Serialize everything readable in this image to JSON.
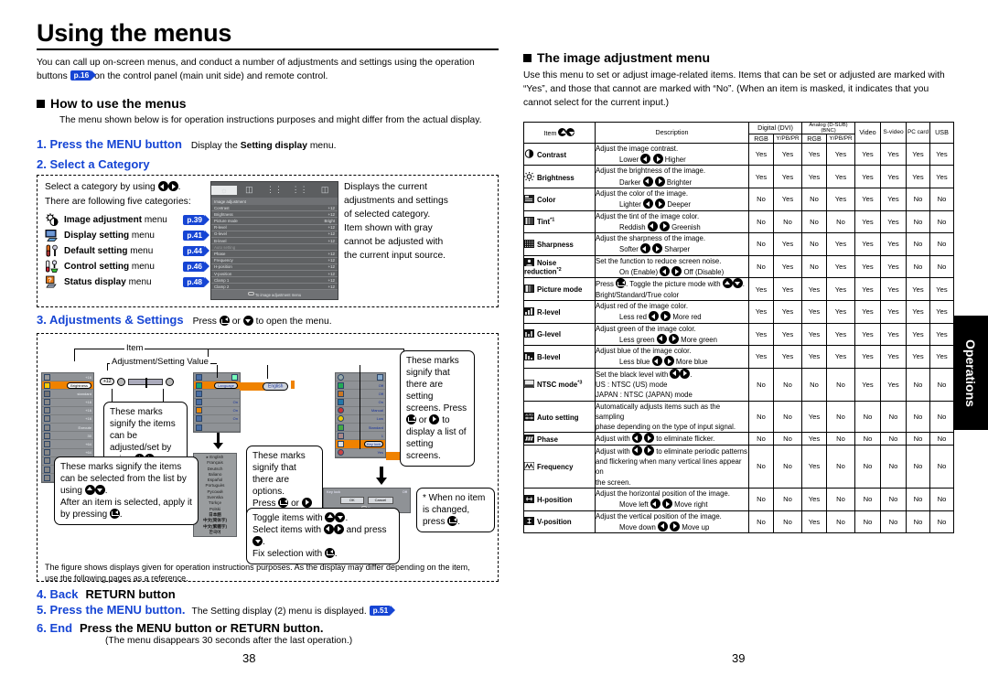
{
  "colors": {
    "accent_blue": "#1645d4",
    "osd_orange": "#ef8200",
    "osd_grey": "#686a6c",
    "tab_black": "#000000"
  },
  "left": {
    "title": "Using the menus",
    "intro_a": "You can call up on-screen menus, and conduct a number of adjustments and settings using the operation buttons",
    "intro_badge": "p.16",
    "intro_b": "on the control panel (main unit side) and remote control.",
    "section_how": "How to use the menus",
    "how_note": "The menu shown below is for operation instructions purposes and might differ from the actual display.",
    "step1_label": "1. Press the MENU button",
    "step1_text_a": "Display the",
    "step1_text_b": "Setting display",
    "step1_text_c": "menu.",
    "step2_label": "2. Select a Category",
    "step2_select_a": "Select a category by using",
    "step2_select_b": ".",
    "step2_five": "There are following five categories:",
    "categories": [
      {
        "icon": "image-adjustment-icon",
        "label": "Image adjustment",
        "suffix": "menu",
        "page": "p.39"
      },
      {
        "icon": "display-setting-icon",
        "label": "Display setting",
        "suffix": "menu",
        "page": "p.41"
      },
      {
        "icon": "default-setting-icon",
        "label": "Default setting",
        "suffix": "menu",
        "page": "p.44"
      },
      {
        "icon": "control-setting-icon",
        "label": "Control setting",
        "suffix": "menu",
        "page": "p.46"
      },
      {
        "icon": "status-display-icon",
        "label": "Status display",
        "suffix": "menu",
        "page": "p.48"
      }
    ],
    "step2_right_note": "Displays the current adjustments and settings of selected category.\nItem shown with gray cannot be adjusted with the current input source.",
    "osd": {
      "title": "Image adjustment",
      "footer": "To image adjustment menu",
      "rows": [
        {
          "name": "Contrast",
          "value": "+12",
          "grey": false
        },
        {
          "name": "Brightness",
          "value": "+12",
          "grey": false
        },
        {
          "name": "Picture mode",
          "value": "Bright",
          "grey": false
        },
        {
          "name": "R-level",
          "value": "+12",
          "grey": false
        },
        {
          "name": "G-level",
          "value": "+12",
          "grey": false
        },
        {
          "name": "B-level",
          "value": "+12",
          "grey": false
        },
        {
          "name": "Auto setting",
          "value": "",
          "grey": true
        },
        {
          "name": "Phase",
          "value": "+12",
          "grey": false
        },
        {
          "name": "Frequency",
          "value": "+12",
          "grey": false
        },
        {
          "name": "H-position",
          "value": "+12",
          "grey": false
        },
        {
          "name": "V-position",
          "value": "+12",
          "grey": false
        },
        {
          "name": "Clamp 1",
          "value": "+12",
          "grey": false
        },
        {
          "name": "Clamp 2",
          "value": "+12",
          "grey": false
        }
      ]
    },
    "step3_label": "3. Adjustments & Settings",
    "step3_press_a": "Press",
    "step3_press_or": "or",
    "step3_press_b": "to open the menu.",
    "fig_item_label": "Item",
    "fig_value_label": "Adjustment/Setting Value",
    "bubble_adjust": "These marks signify the items can be adjusted/set by using",
    "bubble_options_a": "These marks signify that there are options.",
    "bubble_options_b": "Press",
    "bubble_options_or": "or",
    "bubble_options_c": "to display a list of options.",
    "bubble_screens_a": "These marks signify that there are setting screens. Press",
    "bubble_screens_or": "or",
    "bubble_screens_b": "to display a list of setting screens.",
    "bubble_list_a": "These marks signify the items can be selected from the list by using",
    "bubble_list_b": "After an item is selected, apply it by pressing",
    "bubble_noitem": "* When no item is changed, press",
    "bubble_toggle_1a": "Toggle items with",
    "bubble_toggle_2a": "Select items with",
    "bubble_toggle_2b": "and press",
    "bubble_toggle_3a": "Fix selection with",
    "mock_language_label": "Language",
    "mock_language_value": "English",
    "mock_keylock_label": "Key lock",
    "mock_keylock_value": "Off",
    "languages": [
      "English",
      "Français",
      "Deutsch",
      "Italiano",
      "Español",
      "Portuguès",
      "Русский",
      "Svenska",
      "Türkçe",
      "Polski",
      "日本語",
      "中文(简体字)",
      "中文(繁體字)",
      "한국어"
    ],
    "mock_ctrl_values": [
      "",
      "Off",
      "Off",
      "On",
      "Manual",
      "Low",
      "Standard",
      "1"
    ],
    "dialog_title": "Key lock",
    "dialog_value": "Off",
    "dialog_btn_ok": "OK",
    "dialog_btn_cancel": "Cancel",
    "dialog_foot": "Fix",
    "figure_note": "The figure shows displays given for operation instructions purposes.  As the display may differ depending on the item, use the following pages as a reference.",
    "step4_num": "4. Back",
    "step4_label": "RETURN button",
    "step5_num": "5. Press the MENU button.",
    "step5_text": "The Setting display (2) menu is displayed.",
    "step5_badge": "p.51",
    "step6_num": "6. End",
    "step6_label": "Press the MENU button or RETURN button.",
    "step6_note": "(The menu disappears 30 seconds after the last operation.)",
    "page_number": "38"
  },
  "right": {
    "section_title": "The image adjustment menu",
    "intro": "Use this menu to set or adjust image-related items. Items that can be set or adjusted are marked with “Yes”, and those that cannot are marked with “No”. (When an item is masked, it indicates that you cannot select for the current input.)",
    "page_number": "39",
    "side_tab": "Operations",
    "table": {
      "col_item": "Item",
      "col_description": "Description",
      "group_digital": "Digital (DVI)",
      "group_analog": "Analog (D-SUB)(BNC)",
      "sub_rgb": "RGB",
      "sub_ypbpr": "Y/PB/PR",
      "col_video": "Video",
      "col_svideo": "S-video",
      "col_pccard": "PC card",
      "col_usb": "USB",
      "rows": [
        {
          "icon": "contrast-icon",
          "item": "Contrast",
          "note": "",
          "desc_line1": "Adjust the image contrast.",
          "desc_left": "Lower",
          "desc_right": "Higher",
          "values": [
            "Yes",
            "Yes",
            "Yes",
            "Yes",
            "Yes",
            "Yes",
            "Yes",
            "Yes"
          ]
        },
        {
          "icon": "brightness-icon",
          "item": "Brightness",
          "note": "",
          "desc_line1": "Adjust the brightness of the image.",
          "desc_left": "Darker",
          "desc_right": "Brighter",
          "values": [
            "Yes",
            "Yes",
            "Yes",
            "Yes",
            "Yes",
            "Yes",
            "Yes",
            "Yes"
          ]
        },
        {
          "icon": "color-icon",
          "item": "Color",
          "note": "",
          "desc_line1": "Adjust the color of the image.",
          "desc_left": "Lighter",
          "desc_right": "Deeper",
          "values": [
            "No",
            "Yes",
            "No",
            "Yes",
            "Yes",
            "Yes",
            "No",
            "No"
          ]
        },
        {
          "icon": "tint-icon",
          "item": "Tint",
          "note": "*1",
          "desc_line1": "Adjust the tint of the image color.",
          "desc_left": "Reddish",
          "desc_right": "Greenish",
          "values": [
            "No",
            "No",
            "No",
            "No",
            "Yes",
            "Yes",
            "No",
            "No"
          ]
        },
        {
          "icon": "sharpness-icon",
          "item": "Sharpness",
          "note": "",
          "desc_line1": "Adjust the sharpness of the image.",
          "desc_left": "Softer",
          "desc_right": "Sharper",
          "values": [
            "No",
            "Yes",
            "No",
            "Yes",
            "Yes",
            "Yes",
            "No",
            "No"
          ]
        },
        {
          "icon": "noise-reduction-icon",
          "item": "Noise reduction",
          "note": "*2",
          "desc_line1": "Set the function to reduce screen noise.",
          "desc_left": "On (Enable)",
          "desc_right": "Off (Disable)",
          "values": [
            "No",
            "Yes",
            "No",
            "Yes",
            "Yes",
            "Yes",
            "No",
            "No"
          ]
        },
        {
          "icon": "picture-mode-icon",
          "item": "Picture mode",
          "note": "",
          "desc_special": "picture-mode",
          "desc_line1": "Press",
          "desc_mid": ". Toggle the picture mode with",
          "desc_line2": "Bright/Standard/True color",
          "values": [
            "Yes",
            "Yes",
            "Yes",
            "Yes",
            "Yes",
            "Yes",
            "Yes",
            "Yes"
          ]
        },
        {
          "icon": "r-level-icon",
          "item": "R-level",
          "note": "",
          "desc_line1": "Adjust red of the image color.",
          "desc_left": "Less red",
          "desc_right": "More red",
          "values": [
            "Yes",
            "Yes",
            "Yes",
            "Yes",
            "Yes",
            "Yes",
            "Yes",
            "Yes"
          ]
        },
        {
          "icon": "g-level-icon",
          "item": "G-level",
          "note": "",
          "desc_line1": "Adjust green of the image color.",
          "desc_left": "Less green",
          "desc_right": "More green",
          "values": [
            "Yes",
            "Yes",
            "Yes",
            "Yes",
            "Yes",
            "Yes",
            "Yes",
            "Yes"
          ]
        },
        {
          "icon": "b-level-icon",
          "item": "B-level",
          "note": "",
          "desc_line1": "Adjust blue of the image color.",
          "desc_left": "Less blue",
          "desc_right": "More blue",
          "values": [
            "Yes",
            "Yes",
            "Yes",
            "Yes",
            "Yes",
            "Yes",
            "Yes",
            "Yes"
          ]
        },
        {
          "icon": "ntsc-mode-icon",
          "item": "NTSC mode",
          "note": "*3",
          "desc_special": "ntsc",
          "desc_line1": "Set the black level with",
          "desc_line2": "US      :  NTSC (US) mode",
          "desc_line3": "JAPAN :  NTSC (JAPAN) mode",
          "values": [
            "No",
            "No",
            "No",
            "No",
            "Yes",
            "Yes",
            "No",
            "No"
          ]
        },
        {
          "icon": "auto-setting-icon",
          "item": "Auto setting",
          "note": "",
          "desc_special": "plain2",
          "desc_line1": "Automatically adjusts items such as the sampling",
          "desc_line2": "phase depending on the type of input signal.",
          "values": [
            "No",
            "No",
            "Yes",
            "No",
            "No",
            "No",
            "No",
            "No"
          ]
        },
        {
          "icon": "phase-icon",
          "item": "Phase",
          "note": "",
          "desc_special": "inline",
          "desc_line1": "Adjust with",
          "desc_line2": "to eliminate flicker.",
          "values": [
            "No",
            "No",
            "Yes",
            "No",
            "No",
            "No",
            "No",
            "No"
          ]
        },
        {
          "icon": "frequency-icon",
          "item": "Frequency",
          "note": "",
          "desc_special": "inline3",
          "desc_line1": "Adjust with",
          "desc_line2": "to eliminate periodic patterns",
          "desc_line3": "and flickering when many vertical lines appear on",
          "desc_line4": "the screen.",
          "values": [
            "No",
            "No",
            "Yes",
            "No",
            "No",
            "No",
            "No",
            "No"
          ]
        },
        {
          "icon": "h-position-icon",
          "item": "H-position",
          "note": "",
          "desc_line1": "Adjust the horizontal position of the image.",
          "desc_left": "Move left",
          "desc_right": "Move right",
          "values": [
            "No",
            "No",
            "Yes",
            "No",
            "No",
            "No",
            "No",
            "No"
          ]
        },
        {
          "icon": "v-position-icon",
          "item": "V-position",
          "note": "",
          "desc_line1": "Adjust the vertical position of the image.",
          "desc_left": "Move down",
          "desc_right": "Move up",
          "values": [
            "No",
            "No",
            "Yes",
            "No",
            "No",
            "No",
            "No",
            "No"
          ]
        }
      ]
    }
  }
}
